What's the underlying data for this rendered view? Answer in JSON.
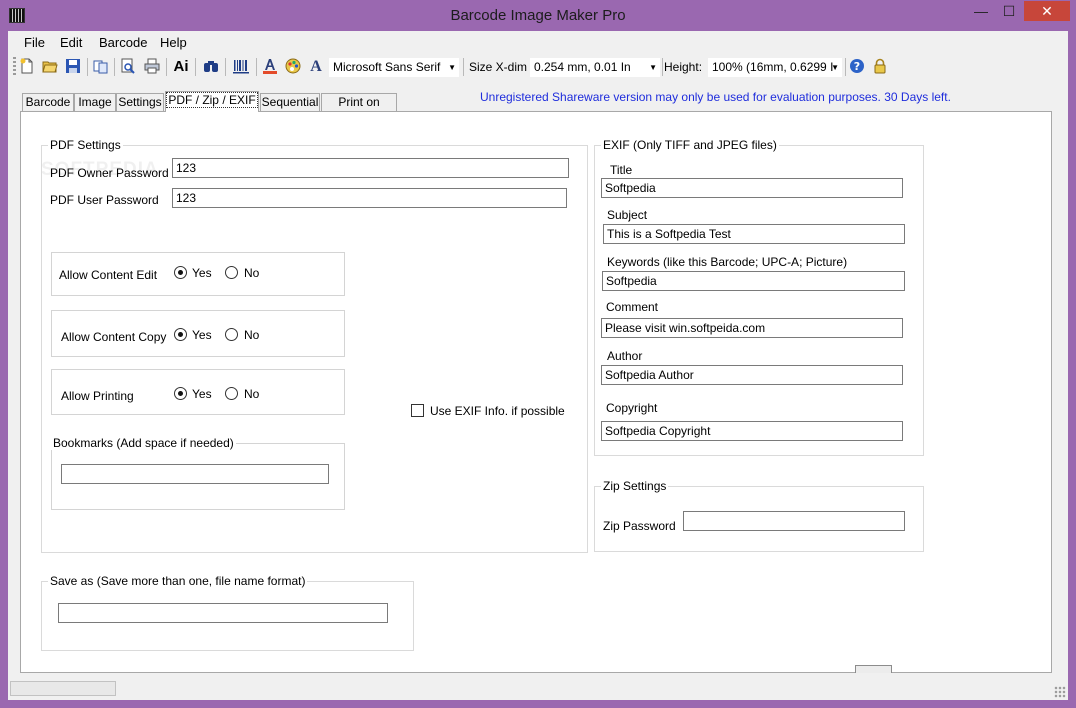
{
  "window": {
    "title": "Barcode Image Maker Pro",
    "minimize_glyph": "—",
    "maximize_glyph": "☐",
    "close_glyph": "✕"
  },
  "menu": [
    "File",
    "Edit",
    "Barcode",
    "Help"
  ],
  "toolbar": {
    "font_name": "Microsoft Sans Serif",
    "size_label": "Size X-dim",
    "size_value": "0.254 mm, 0.01 In",
    "height_label": "Height:",
    "height_value": "100% (16mm, 0.6299 I",
    "text_icon_label": "Ai",
    "font_icon_label": "A",
    "icons": [
      "new-icon",
      "open-icon",
      "save-icon",
      "copy-icon",
      "print-preview-icon",
      "print-icon",
      "text-icon",
      "find-icon",
      "barcode-icon",
      "font-color-icon",
      "color-palette-icon",
      "font-icon",
      "help-icon",
      "lock-icon"
    ]
  },
  "tabs": [
    "Barcode",
    "Image",
    "Settings",
    "PDF / Zip / EXIF",
    "Sequential",
    "Print on Label"
  ],
  "active_tab": "PDF / Zip / EXIF",
  "notice": "Unregistered Shareware version may only be used for evaluation purposes. 30 Days left.",
  "pdf": {
    "legend": "PDF Settings",
    "owner_password_label": "PDF Owner Password",
    "owner_password_value": "123",
    "user_password_label": "PDF User Password",
    "user_password_value": "123",
    "permissions": [
      {
        "label": "Allow Content Edit",
        "selected": "Yes"
      },
      {
        "label": "Allow Content Copy",
        "selected": "Yes"
      },
      {
        "label": "Allow Printing",
        "selected": "Yes"
      }
    ],
    "yes_label": "Yes",
    "no_label": "No",
    "use_exif_label": "Use EXIF Info. if possible",
    "use_exif_checked": false,
    "bookmarks_legend": "Bookmarks (Add space if needed)",
    "bookmarks_value": ""
  },
  "exif": {
    "legend": "EXIF (Only TIFF and JPEG files)",
    "fields": [
      {
        "label": "Title",
        "value": "Softpedia"
      },
      {
        "label": "Subject",
        "value": "This is a Softpedia Test"
      },
      {
        "label": "Keywords (like this Barcode; UPC-A; Picture)",
        "value": "Softpedia"
      },
      {
        "label": "Comment",
        "value": "Please visit win.softpeida.com"
      },
      {
        "label": "Author",
        "value": "Softpedia Author"
      },
      {
        "label": "Copyright",
        "value": "Softpedia Copyright"
      }
    ]
  },
  "zip": {
    "legend": "Zip Settings",
    "password_label": "Zip Password",
    "password_value": ""
  },
  "save_as": {
    "legend": "Save as (Save more than one, file name format)",
    "value": ""
  },
  "watermark": "SOFTPEDIA",
  "colors": {
    "title_bar": "#9a68b0",
    "notice_text": "#1f2ddc",
    "close_button": "#c7463a"
  }
}
